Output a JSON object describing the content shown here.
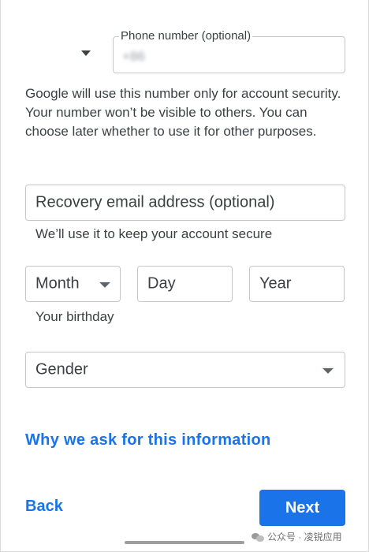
{
  "phone": {
    "label": "Phone number (optional)",
    "value": "+86"
  },
  "info_text": "Google will use this number only for account security. Your number won’t be visible to others. You can choose later whether to use it for other purposes.",
  "recovery": {
    "placeholder": "Recovery email address (optional)",
    "hint": "We’ll use it to keep your account secure"
  },
  "birthday": {
    "month_placeholder": "Month",
    "day_placeholder": "Day",
    "year_placeholder": "Year",
    "hint": "Your birthday"
  },
  "gender": {
    "placeholder": "Gender"
  },
  "why_link": "Why we ask for this information",
  "actions": {
    "back_label": "Back",
    "next_label": "Next"
  },
  "watermark": "公众号 · 凌锐应用",
  "colors": {
    "accent": "#1a73e8",
    "border": "#c7c7c7",
    "text": "#3c4043"
  }
}
